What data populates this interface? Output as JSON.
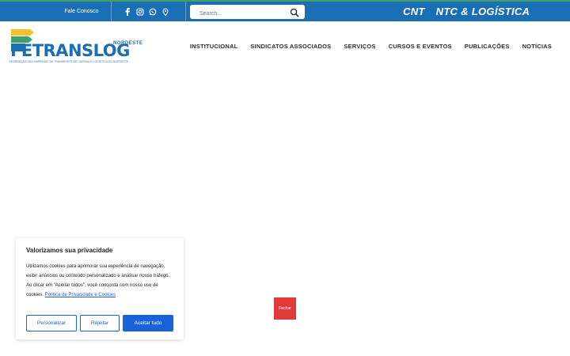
{
  "topbar": {
    "contact_label": "Fale Conosco",
    "social_icons": [
      "facebook-icon",
      "instagram-icon",
      "whatsapp-icon",
      "location-pin-icon"
    ],
    "search_placeholder": "Search...",
    "links": [
      "CNT",
      "NTC & LOGÍSTICA"
    ]
  },
  "logo": {
    "name": "FETRANSLOG",
    "region": "NORDESTE",
    "tagline": "FEDERAÇÃO DAS EMPRESAS DE TRANSPORTE DE CARGAS E LOGÍSTICA DO NORDESTE"
  },
  "nav": {
    "items": [
      "INSTITUCIONAL",
      "SINDICATOS ASSOCIADOS",
      "SERVIÇOS",
      "CURSOS E EVENTOS",
      "PUBLICAÇÕES",
      "NOTÍCIAS"
    ]
  },
  "cookie_banner": {
    "title": "Valorizamos sua privacidade",
    "text": "Utilizamos cookies para aprimorar sua experiência de navegação, exibir anúncios ou conteúdo personalizado e analisar nosso tráfego. Ao clicar em \"Aceitar todos\", você concorda com nosso uso de cookies.",
    "policy_link": "Política de Privacidade e Cookies",
    "buttons": {
      "customize": "Personalizar",
      "reject": "Rejeitar",
      "accept": "Aceitar tudo"
    }
  },
  "close_button": "Fechar",
  "colors": {
    "primary_blue": "#1a6fb4",
    "accent_green": "#3fa06a",
    "cookie_blue": "#1863dc",
    "close_red": "#e13a3a"
  }
}
